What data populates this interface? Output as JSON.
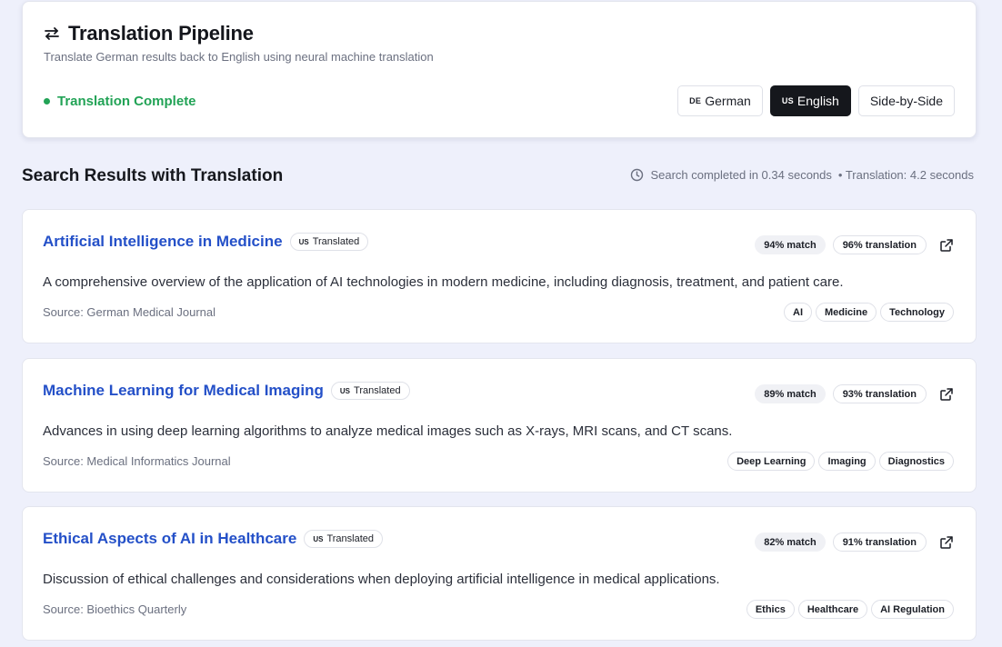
{
  "header": {
    "title": "Translation Pipeline",
    "subtitle": "Translate German results back to English using neural machine translation",
    "status": "Translation Complete",
    "icon": "swap-arrows-icon",
    "languages": [
      {
        "code": "DE",
        "label": "German",
        "active": false
      },
      {
        "code": "US",
        "label": "English",
        "active": true
      },
      {
        "code": "",
        "label": "Side-by-Side",
        "active": false
      }
    ]
  },
  "section": {
    "title": "Search Results with Translation",
    "search_time": "Search completed in 0.34 seconds",
    "translation_time": "• Translation: 4.2 seconds"
  },
  "colors": {
    "status_green": "#22a356",
    "link_blue": "#2450c8",
    "active_button": "#15171c"
  },
  "results": [
    {
      "title": "Artificial Intelligence in Medicine",
      "badge_code": "US",
      "badge_label": "Translated",
      "match": "94% match",
      "translation": "96% translation",
      "description": "A comprehensive overview of the application of AI technologies in modern medicine, including diagnosis, treatment, and patient care.",
      "source": "Source: German Medical Journal",
      "tags": [
        "AI",
        "Medicine",
        "Technology"
      ]
    },
    {
      "title": "Machine Learning for Medical Imaging",
      "badge_code": "US",
      "badge_label": "Translated",
      "match": "89% match",
      "translation": "93% translation",
      "description": "Advances in using deep learning algorithms to analyze medical images such as X-rays, MRI scans, and CT scans.",
      "source": "Source: Medical Informatics Journal",
      "tags": [
        "Deep Learning",
        "Imaging",
        "Diagnostics"
      ]
    },
    {
      "title": "Ethical Aspects of AI in Healthcare",
      "badge_code": "US",
      "badge_label": "Translated",
      "match": "82% match",
      "translation": "91% translation",
      "description": "Discussion of ethical challenges and considerations when deploying artificial intelligence in medical applications.",
      "source": "Source: Bioethics Quarterly",
      "tags": [
        "Ethics",
        "Healthcare",
        "AI Regulation"
      ]
    }
  ]
}
